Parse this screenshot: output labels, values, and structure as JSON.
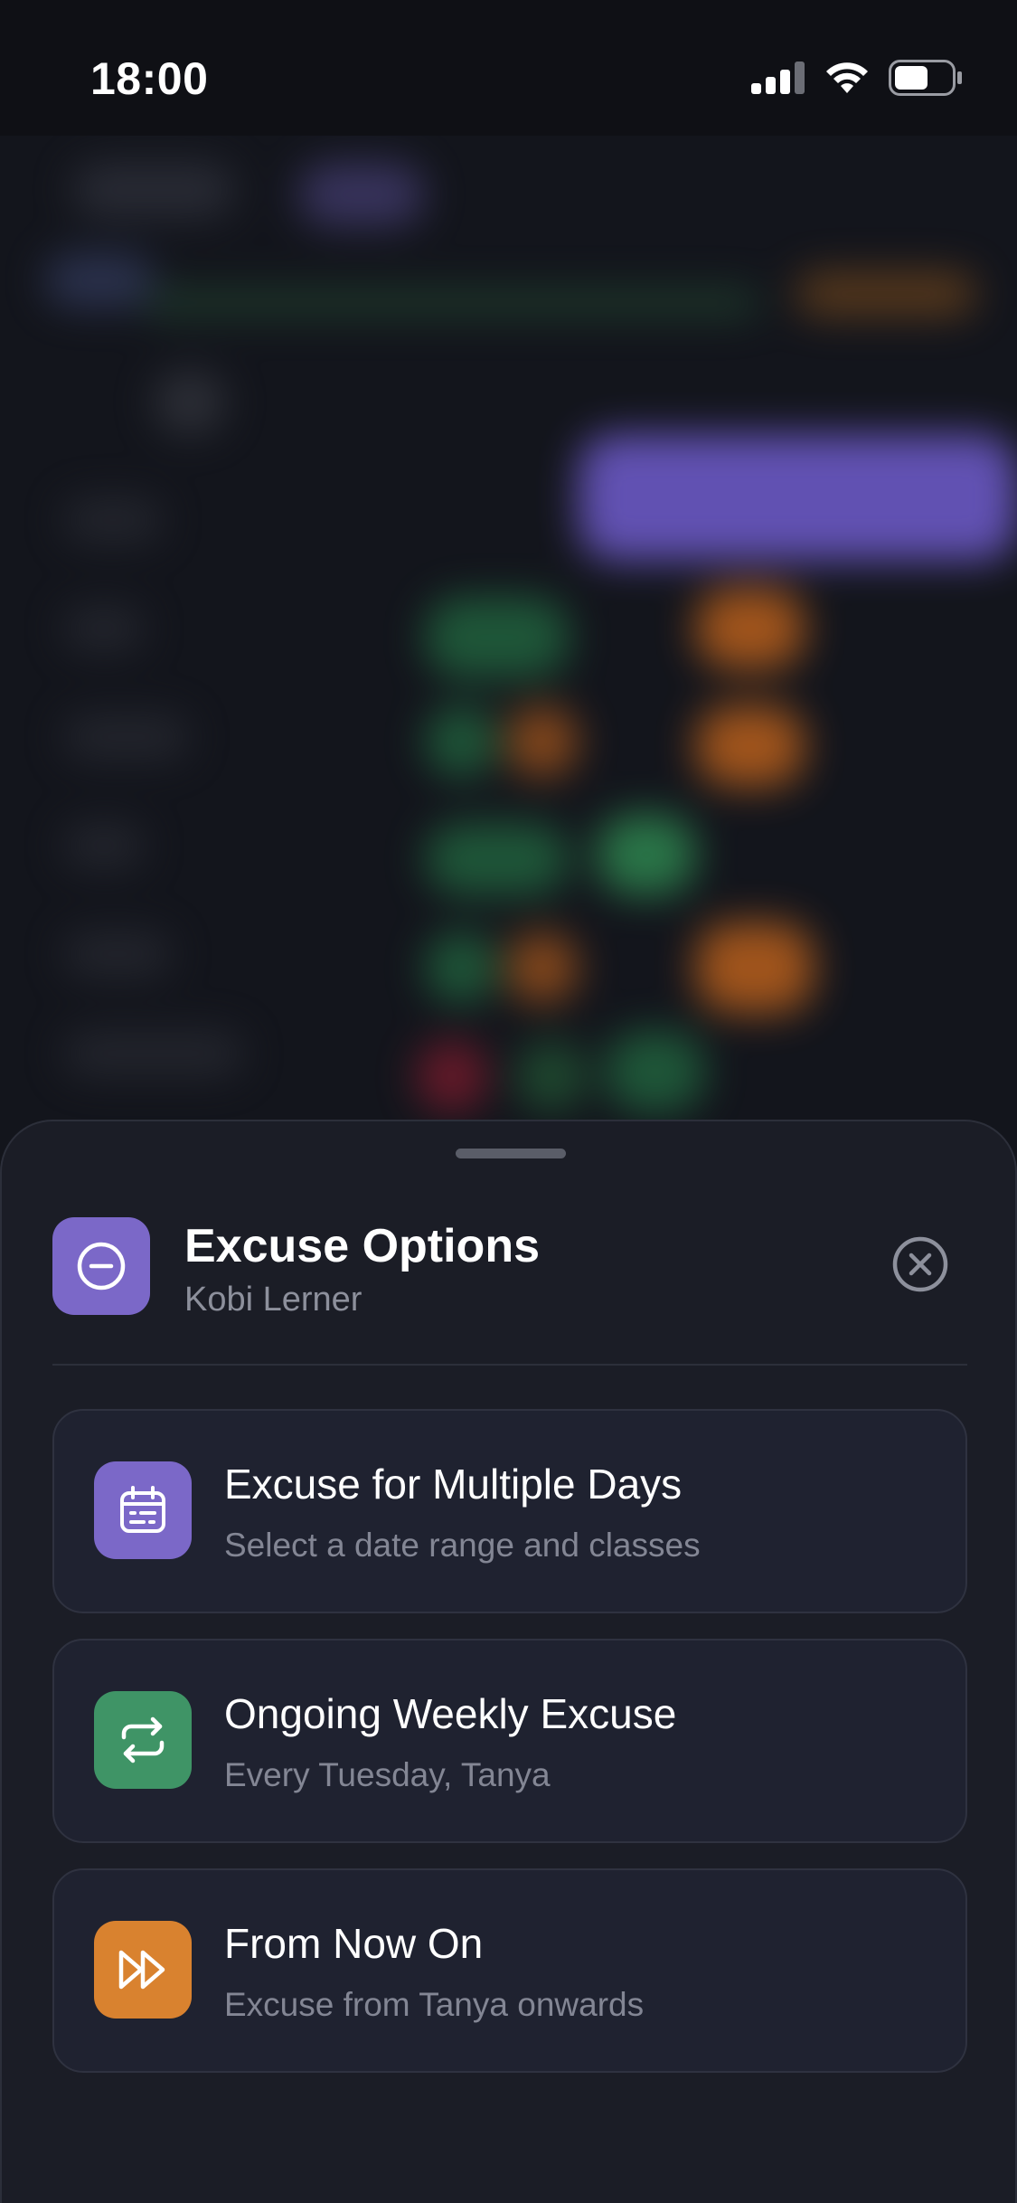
{
  "status_bar": {
    "time": "18:00",
    "icons": [
      "signal-icon",
      "wifi-icon",
      "battery-icon"
    ]
  },
  "sheet": {
    "title": "Excuse Options",
    "subtitle": "Kobi Lerner",
    "header_icon": "minus-circle-icon",
    "close_icon": "close-circle-icon",
    "options": [
      {
        "title": "Excuse for Multiple Days",
        "subtitle": "Select a date range and classes",
        "icon": "calendar-icon",
        "color": "#7b68c8"
      },
      {
        "title": "Ongoing Weekly Excuse",
        "subtitle": "Every Tuesday, Tanya",
        "icon": "repeat-icon",
        "color": "#3f9466"
      },
      {
        "title": "From Now On",
        "subtitle": "Excuse from Tanya onwards",
        "icon": "fast-forward-icon",
        "color": "#d9822f"
      }
    ]
  },
  "colors": {
    "accent_purple": "#7b68c8",
    "accent_green": "#3f9466",
    "accent_orange": "#d9822f",
    "sheet_bg": "#1b1d26"
  }
}
